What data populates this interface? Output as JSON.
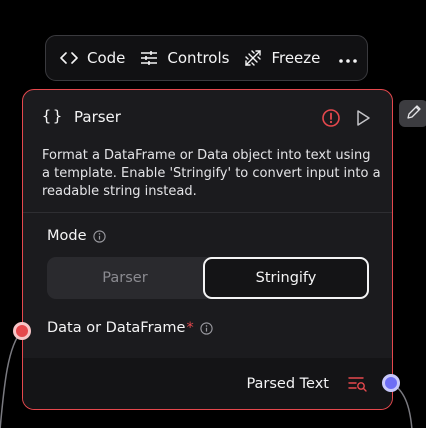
{
  "toolbar": {
    "code_label": "Code",
    "controls_label": "Controls",
    "freeze_label": "Freeze",
    "more_icon": "more-horizontal-icon"
  },
  "node": {
    "title": "Parser",
    "title_icon": "{}",
    "description": "Format a DataFrame or Data object into text using a template. Enable 'Stringify' to convert input into a readable string instead.",
    "status_icon": "alert-circle-icon",
    "run_icon": "play-icon",
    "mode": {
      "label": "Mode",
      "options": [
        "Parser",
        "Stringify"
      ],
      "selected": "Stringify"
    },
    "input": {
      "label": "Data or DataFrame",
      "required_mark": "*"
    },
    "output": {
      "label": "Parsed Text",
      "icon": "inspect-output-icon"
    }
  },
  "colors": {
    "accent_error": "#e5484d",
    "output_handle": "#6e6ef5",
    "background": "#000000",
    "node_bg": "#1b1b1e"
  }
}
